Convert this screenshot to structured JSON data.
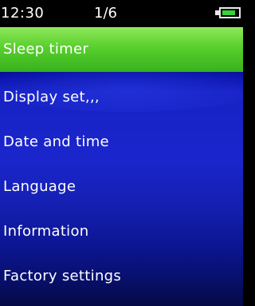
{
  "status_bar": {
    "time": "12:30",
    "page": "1/6",
    "battery_level": 0.85,
    "battery_color": "#38d23a"
  },
  "menu": {
    "selected_index": 0,
    "selected_color": "#58cf2c",
    "items": [
      {
        "label": "Sleep timer"
      },
      {
        "label": "Display set,,,"
      },
      {
        "label": "Date and time"
      },
      {
        "label": "Language"
      },
      {
        "label": "Information"
      },
      {
        "label": "Factory settings"
      }
    ]
  },
  "colors": {
    "background_top": "#0a0a6a",
    "background_mid": "#1a26cc",
    "background_bottom": "#050a45",
    "text": "#ffffff"
  }
}
